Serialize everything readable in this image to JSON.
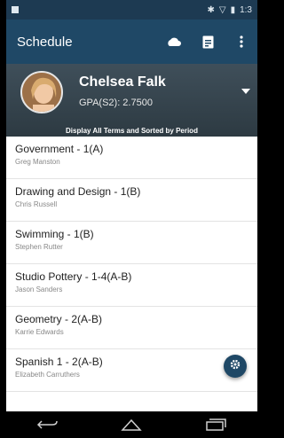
{
  "status_bar": {
    "time": "1:3"
  },
  "app_bar": {
    "title": "Schedule",
    "actions": [
      "cloud-icon",
      "document-icon",
      "overflow-menu-icon"
    ]
  },
  "profile": {
    "name": "Chelsea Falk",
    "gpa": "GPA(S2): 2.7500",
    "filter_label": "Display All Terms and Sorted by Period"
  },
  "courses": [
    {
      "course": "Government - 1(A)",
      "teacher": "Greg Manston"
    },
    {
      "course": "Drawing and Design - 1(B)",
      "teacher": "Chris Russell"
    },
    {
      "course": "Swimming - 1(B)",
      "teacher": "Stephen Rutter"
    },
    {
      "course": "Studio Pottery - 1-4(A-B)",
      "teacher": "Jason Sanders"
    },
    {
      "course": "Geometry - 2(A-B)",
      "teacher": "Karrie Edwards"
    },
    {
      "course": "Spanish 1 - 2(A-B)",
      "teacher": "Elizabeth Carruthers"
    }
  ],
  "colors": {
    "app_bar": "#1f4866",
    "status_bar": "#1d3a52",
    "fab": "#1f4866"
  }
}
